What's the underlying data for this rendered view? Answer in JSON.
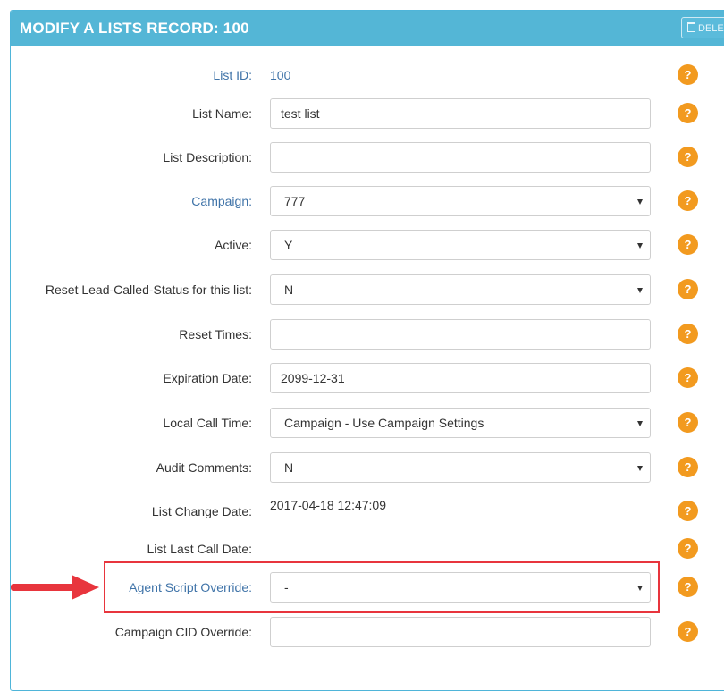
{
  "panel": {
    "title": "MODIFY A LISTS RECORD: 100",
    "delete_label": "DELETE"
  },
  "fields": {
    "list_id": {
      "label": "List ID:",
      "value": "100"
    },
    "list_name": {
      "label": "List Name:",
      "value": "test list"
    },
    "list_description": {
      "label": "List Description:",
      "value": ""
    },
    "campaign": {
      "label": "Campaign:",
      "value": "777"
    },
    "active": {
      "label": "Active:",
      "value": "Y"
    },
    "reset_lead_called_status": {
      "label": "Reset Lead-Called-Status for this list:",
      "value": "N"
    },
    "reset_times": {
      "label": "Reset Times:",
      "value": ""
    },
    "expiration_date": {
      "label": "Expiration Date:",
      "value": "2099-12-31"
    },
    "local_call_time": {
      "label": "Local Call Time:",
      "value": "Campaign - Use Campaign Settings"
    },
    "audit_comments": {
      "label": "Audit Comments:",
      "value": "N"
    },
    "list_change_date": {
      "label": "List Change Date:",
      "value": "2017-04-18 12:47:09"
    },
    "list_last_call_date": {
      "label": "List Last Call Date:",
      "value": ""
    },
    "agent_script_override": {
      "label": "Agent Script Override:",
      "value": "-"
    },
    "campaign_cid_override": {
      "label": "Campaign CID Override:",
      "value": ""
    }
  },
  "help_symbol": "?",
  "icons": {
    "help": "help-icon",
    "dropdown": "chevron-down-icon",
    "delete": "trash-icon",
    "annotation_arrow": "arrow-right-icon"
  },
  "colors": {
    "header": "#54b6d6",
    "link": "#3f73a8",
    "help_badge": "#f29a1f",
    "highlight": "#e8353d"
  }
}
